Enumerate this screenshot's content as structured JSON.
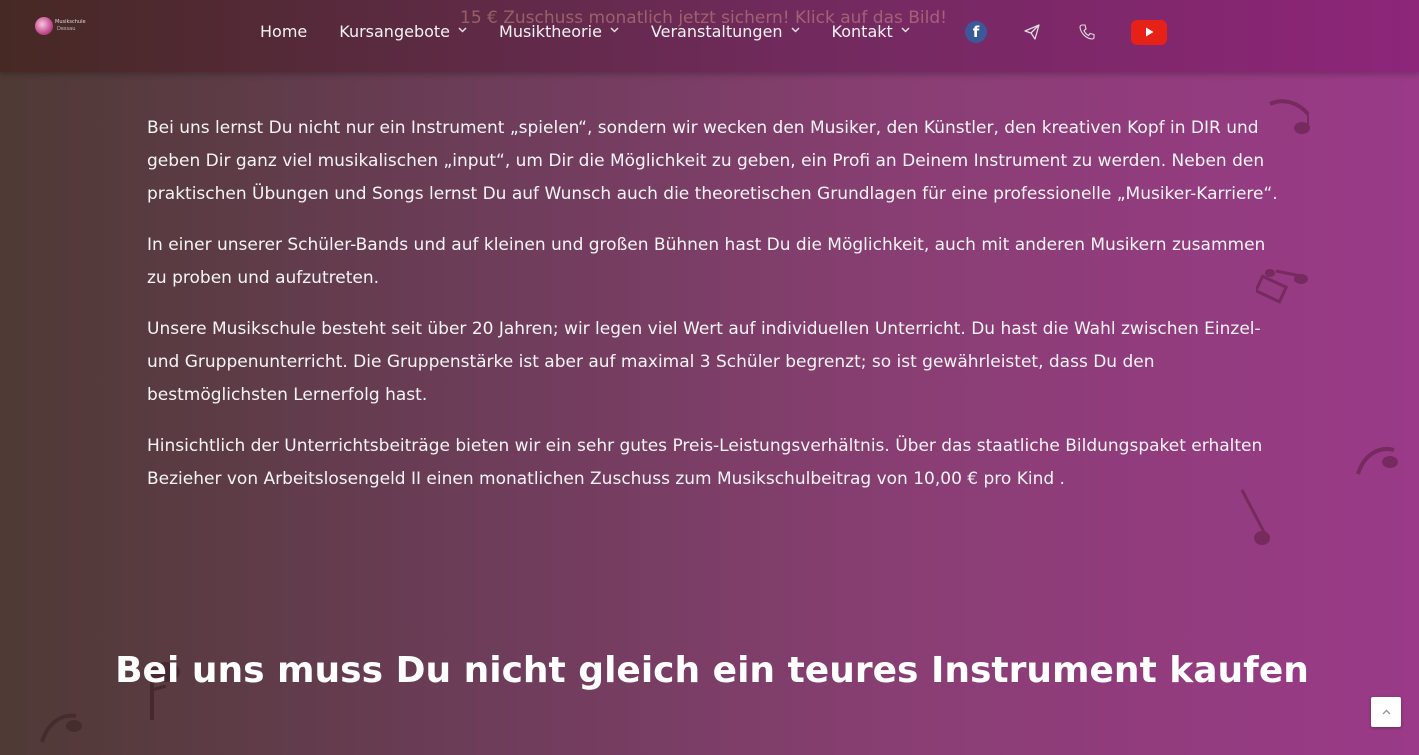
{
  "banner": {
    "text": "15 € Zuschuss monatlich jetzt sichern! Klick auf das Bild!"
  },
  "logo": {
    "line1": "Musikschule",
    "line2": "Dessau"
  },
  "nav": {
    "items": [
      {
        "label": "Home",
        "dropdown": false
      },
      {
        "label": "Kursangebote",
        "dropdown": true
      },
      {
        "label": "Musiktheorie",
        "dropdown": true
      },
      {
        "label": "Veranstaltungen",
        "dropdown": true
      },
      {
        "label": "Kontakt",
        "dropdown": true
      }
    ],
    "chevron": "⌄"
  },
  "social": {
    "facebook": {
      "icon": "facebook-icon",
      "glyph": "f",
      "color": "#3b5998"
    },
    "telegram": {
      "icon": "telegram-icon"
    },
    "phone": {
      "icon": "phone-icon"
    },
    "youtube": {
      "icon": "youtube-icon",
      "color": "#e62117"
    }
  },
  "content": {
    "paragraphs": [
      "Bei uns lernst Du nicht nur ein Instrument „spielen“, sondern wir wecken den Musiker, den Künstler, den kreativen Kopf in DIR und geben Dir ganz viel musikalischen „input“, um Dir die Möglichkeit zu geben, ein Profi an Deinem Instrument zu werden. Neben den praktischen Übungen und Songs lernst Du auf Wunsch auch die theoretischen Grundlagen für eine professionelle „Musiker-Karriere“.",
      "In einer unserer Schüler-Bands und auf kleinen und großen Bühnen hast Du die Möglichkeit, auch mit anderen Musikern zusammen zu proben und aufzutreten.",
      "Unsere Musikschule besteht seit über 20 Jahren; wir legen viel Wert auf individuellen Unterricht. Du hast die Wahl zwischen Einzel- und Gruppenunterricht. Die Gruppenstärke ist aber auf maximal  3 Schüler begrenzt; so ist gewährleistet, dass Du den bestmöglichsten Lernerfolg hast.",
      "Hinsichtlich der Unterrichtsbeiträge bieten wir ein sehr gutes Preis-Leistungsverhältnis. Über das staatliche Bildungspaket erhalten Bezieher von Arbeitslosengeld II einen monatlichen Zuschuss zum Musikschulbeitrag von 10,00 € pro Kind ."
    ],
    "heading": "Bei uns muss Du nicht gleich ein teures Instrument kaufen"
  },
  "scroll_top": {
    "icon": "chevron-up-icon",
    "glyph": "⌃"
  },
  "colors": {
    "header_left": "#462823",
    "header_right": "#8c2378",
    "background_left": "#4f3a35",
    "background_right": "#9a3a88",
    "note": "#6b2147"
  }
}
